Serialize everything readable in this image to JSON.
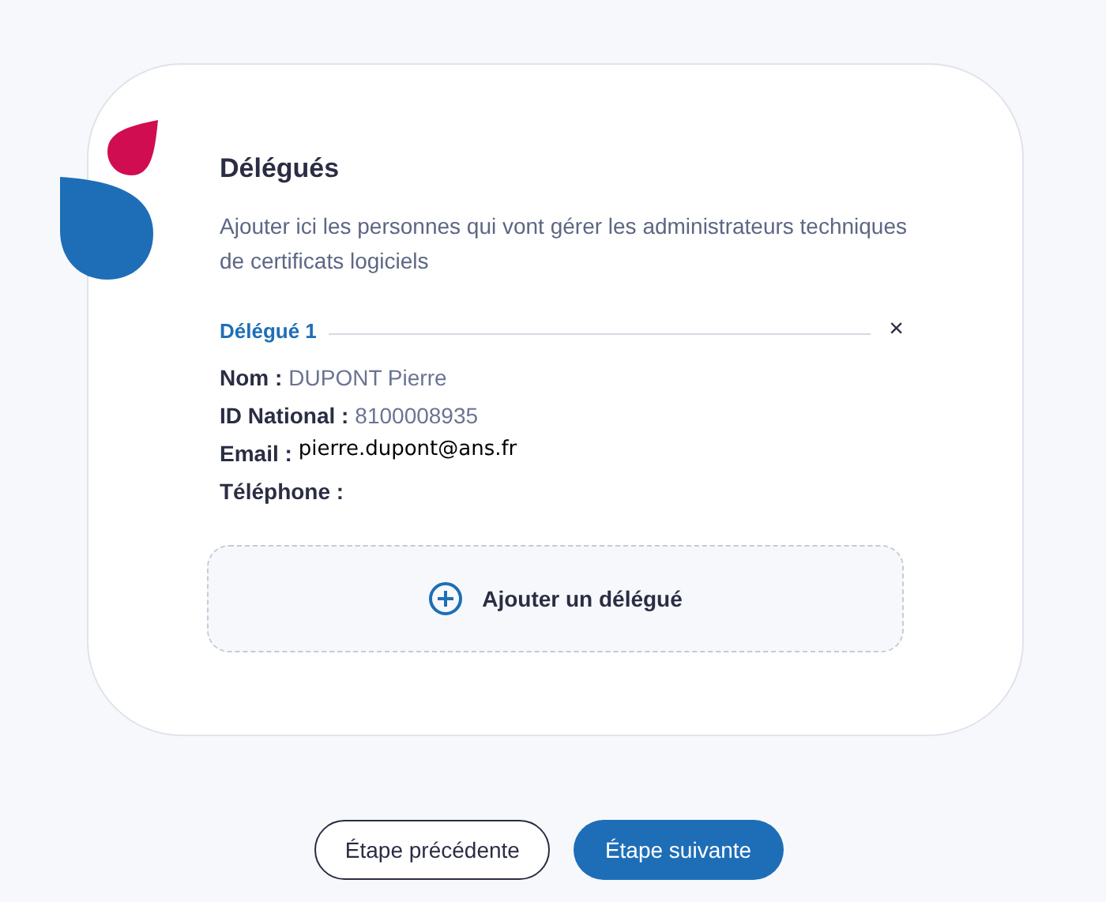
{
  "section": {
    "title": "Délégués",
    "description": "Ajouter ici les personnes qui vont gérer les administrateurs techniques de certificats logiciels"
  },
  "delegates": [
    {
      "heading": "Délégué 1",
      "remove": "×",
      "fields": [
        {
          "label": "Nom :",
          "value": "DUPONT Pierre",
          "kind": "text"
        },
        {
          "label": "ID National :",
          "value": "8100008935",
          "kind": "text"
        },
        {
          "label": "Email :",
          "value": "pierre.dupont@ans.fr",
          "kind": "entry"
        },
        {
          "label": "Téléphone :"
        }
      ]
    }
  ],
  "add_button": {
    "label": "Ajouter un délégué"
  },
  "buttons": [
    {
      "label": "Étape précédente",
      "kind": "secondary"
    },
    {
      "label": "Étape suivante",
      "kind": "primary"
    }
  ]
}
